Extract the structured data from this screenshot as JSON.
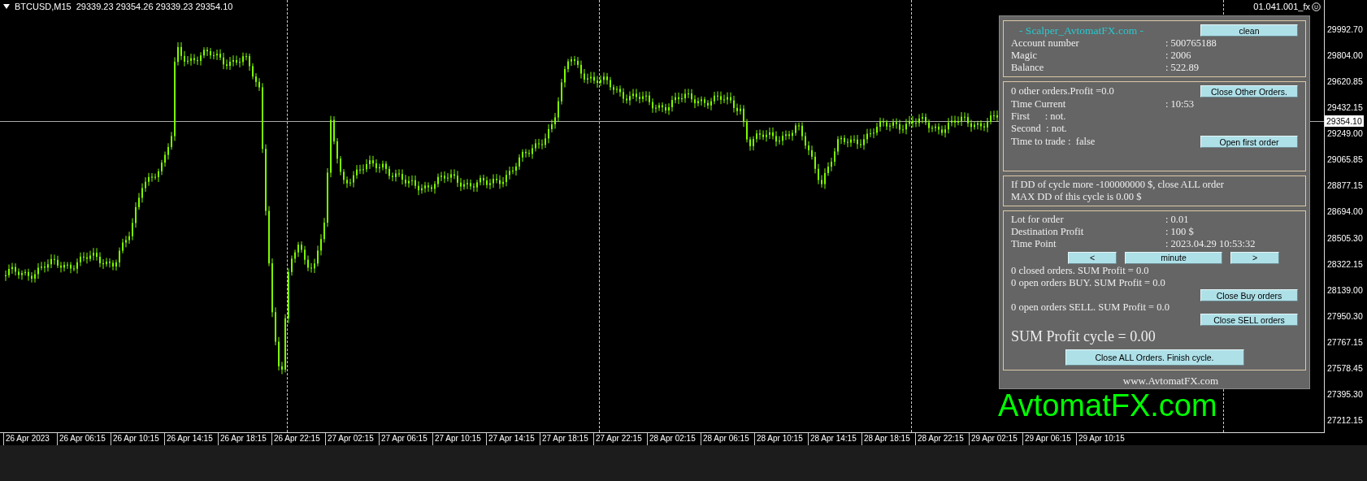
{
  "chart_header": {
    "symbol": "BTCUSD,M15",
    "ohlc": "29339.23 29354.26 29339.23 29354.10"
  },
  "corner_label": "01.041.001_fx",
  "price_axis": [
    "29992.70",
    "29804.00",
    "29620.85",
    "29432.15",
    "29249.00",
    "29065.85",
    "28877.15",
    "28694.00",
    "28505.30",
    "28322.15",
    "28139.00",
    "27950.30",
    "27767.15",
    "27578.45",
    "27395.30",
    "27212.15"
  ],
  "current_price": "29354.10",
  "time_axis": [
    "26 Apr 2023",
    "26 Apr 06:15",
    "26 Apr 10:15",
    "26 Apr 14:15",
    "26 Apr 18:15",
    "26 Apr 22:15",
    "27 Apr 02:15",
    "27 Apr 06:15",
    "27 Apr 10:15",
    "27 Apr 14:15",
    "27 Apr 18:15",
    "27 Apr 22:15",
    "28 Apr 02:15",
    "28 Apr 06:15",
    "28 Apr 10:15",
    "28 Apr 14:15",
    "28 Apr 18:15",
    "28 Apr 22:15",
    "29 Apr 02:15",
    "29 Apr 06:15",
    "29 Apr 10:15"
  ],
  "chart_watermark": "AvtomatFX.com",
  "panel": {
    "sections": [
      {
        "items": [
          {
            "kind": "title",
            "text": "- Scalper_AvtomatFX.com -",
            "button": "clean"
          },
          {
            "kind": "pair",
            "label": "Account number",
            "value": ": 500765188"
          },
          {
            "kind": "pair",
            "label": "Magic",
            "value": ": 2006"
          },
          {
            "kind": "pair",
            "label": "Balance",
            "value": ": 522.89"
          }
        ]
      },
      {
        "items": [
          {
            "kind": "text",
            "text": "0 other orders.Profit =0.0",
            "button": "Close Other Orders."
          },
          {
            "kind": "pair",
            "label": "Time Current",
            "value": ": 10:53"
          },
          {
            "kind": "text",
            "text": "First      : not."
          },
          {
            "kind": "text",
            "text": "Second  : not."
          },
          {
            "kind": "text",
            "text": "Time to trade :  false",
            "button": "Open first order"
          }
        ]
      },
      {
        "items": [
          {
            "kind": "text",
            "text": "If DD of cycle more -100000000 $, close ALL order"
          },
          {
            "kind": "text",
            "text": "MAX DD of this cycle is 0.00 $"
          }
        ]
      },
      {
        "items": [
          {
            "kind": "pair",
            "label": "Lot for order",
            "value": ": 0.01"
          },
          {
            "kind": "pair",
            "label": "Destination Profit",
            "value": ": 100 $"
          },
          {
            "kind": "pair",
            "label": "Time Point",
            "value": ": 2023.04.29 10:53:32"
          },
          {
            "kind": "buttons",
            "buttons": [
              "<",
              "minute",
              ">"
            ]
          },
          {
            "kind": "text",
            "text": "0 closed orders. SUM Profit = 0.0"
          },
          {
            "kind": "text",
            "text": "0 open orders BUY. SUM Profit = 0.0"
          },
          {
            "kind": "button",
            "button": "Close Buy orders"
          },
          {
            "kind": "text",
            "text": "0 open orders SELL. SUM Profit = 0.0"
          },
          {
            "kind": "button",
            "button": "Close SELL orders"
          },
          {
            "kind": "big",
            "text": "SUM Profit cycle = 0.00"
          },
          {
            "kind": "center",
            "button": "Close ALL Orders. Finish cycle."
          }
        ]
      }
    ],
    "footer": "www.AvtomatFX.com"
  }
}
